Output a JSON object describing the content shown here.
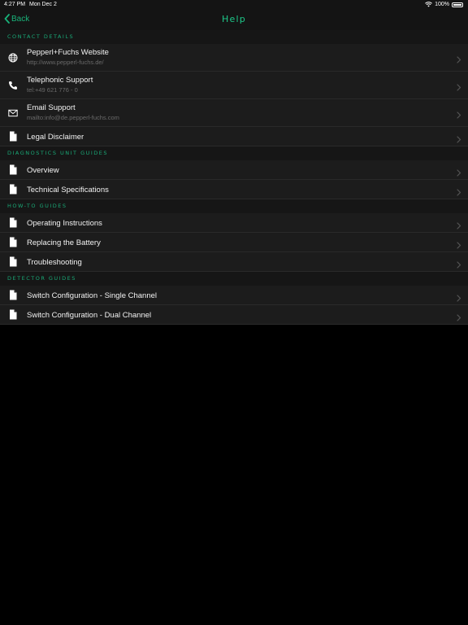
{
  "status_bar": {
    "time": "4:27 PM",
    "date": "Mon Dec 2",
    "battery": "100%"
  },
  "nav": {
    "back_label": "Back",
    "title": "Help"
  },
  "colors": {
    "accent": "#19b37a",
    "row_bg": "#1c1c1c",
    "section_bg": "#161616",
    "page_bg": "#000000"
  },
  "sections": [
    {
      "header": "CONTACT DETAILS",
      "rows": [
        {
          "icon": "globe-icon",
          "title": "Pepperl+Fuchs Website",
          "subtitle": "http://www.pepperl-fuchs.de/"
        },
        {
          "icon": "phone-icon",
          "title": "Telephonic Support",
          "subtitle": "tel:+49 621 776 - 0"
        },
        {
          "icon": "mail-icon",
          "title": "Email Support",
          "subtitle": "mailto:info@de.pepperl-fuchs.com"
        },
        {
          "icon": "document-icon",
          "title": "Legal Disclaimer"
        }
      ]
    },
    {
      "header": "DIAGNOSTICS UNIT GUIDES",
      "rows": [
        {
          "icon": "document-icon",
          "title": "Overview"
        },
        {
          "icon": "document-icon",
          "title": "Technical Specifications"
        }
      ]
    },
    {
      "header": "HOW-TO GUIDES",
      "rows": [
        {
          "icon": "document-icon",
          "title": "Operating Instructions"
        },
        {
          "icon": "document-icon",
          "title": "Replacing the Battery"
        },
        {
          "icon": "document-icon",
          "title": "Troubleshooting"
        }
      ]
    },
    {
      "header": "DETECTOR GUIDES",
      "rows": [
        {
          "icon": "document-icon",
          "title": "Switch Configuration - Single Channel"
        },
        {
          "icon": "document-icon",
          "title": "Switch Configuration - Dual Channel"
        }
      ]
    }
  ]
}
